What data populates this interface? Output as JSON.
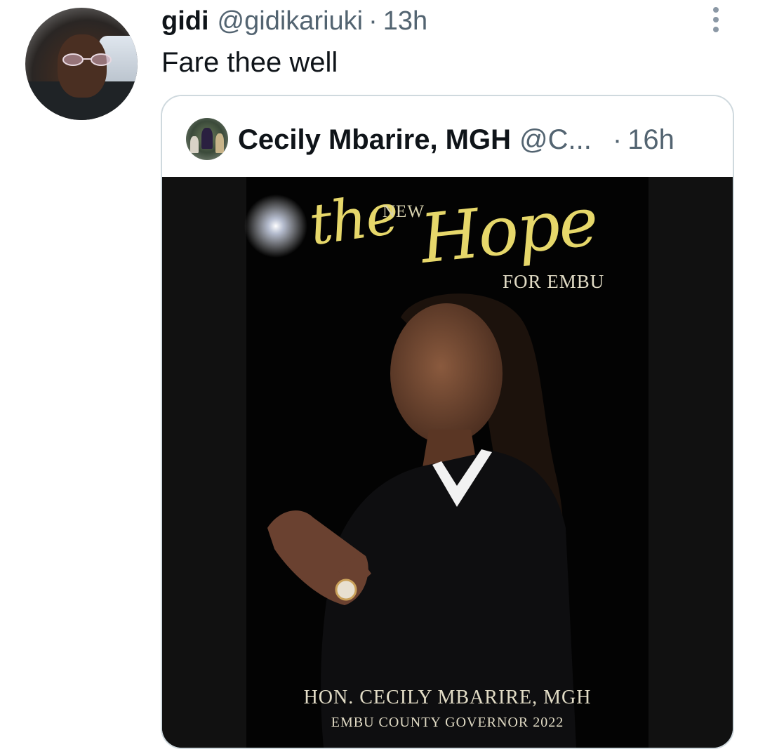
{
  "tweet": {
    "author_name": "gidi",
    "author_handle": "@gidikariuki",
    "separator": "·",
    "time": "13h",
    "text": "Fare thee well"
  },
  "quoted_tweet": {
    "author_name": "Cecily Mbarire, MGH",
    "author_handle": "@C...",
    "separator": "·",
    "time": "16h",
    "image": {
      "poster_script_the": "the",
      "poster_script_hope": "Hope",
      "poster_new": "NEW",
      "poster_for": "FOR EMBU",
      "poster_name": "HON. CECILY MBARIRE, MGH",
      "poster_title": "EMBU COUNTY GOVERNOR 2022"
    }
  },
  "icons": {
    "more": "more-vertical-icon"
  },
  "colors": {
    "text_primary": "#0f1419",
    "text_secondary": "#536471",
    "border": "#cfd9de",
    "poster_gold": "#e6d76a"
  }
}
